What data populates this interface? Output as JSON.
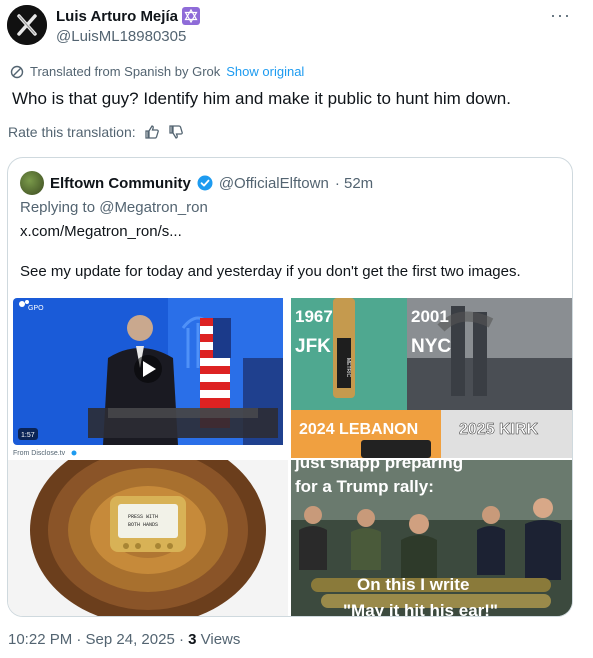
{
  "author": {
    "name": "Luis Arturo Mejía",
    "handle": "@LuisML18980305"
  },
  "translation": {
    "note": "Translated from Spanish by Grok",
    "show_original": "Show original",
    "rate_label": "Rate this translation:"
  },
  "tweet_text": "Who is that guy? Identify him and make it public to hunt him down.",
  "quoted": {
    "name": "Elftown Community",
    "handle": "@OfficialElftown",
    "time": "· 52m",
    "replying": "Replying to @Megatron_ron",
    "link": "x.com/Megatron_ron/s...",
    "text": "See my update for today and yesterday if you don't get the first two images.",
    "images": {
      "img1": {
        "badge": "GPO",
        "duration": "1:57",
        "credit": "From Disclose.tv"
      },
      "img2": {
        "top_left": "1967\nJFK",
        "top_right": "2001\nNYC",
        "bottom_left": "2024 LEBANON",
        "bottom_right": "2025 KIRK",
        "cartridge": "METRIC"
      },
      "img3": {
        "pager_text": "PRESS WITH BOTH HANDS"
      },
      "img4": {
        "caption_top": "for a Trump rally:",
        "caption_bottom": "On this I write",
        "caption_cut": "\"May it hit his ear!\""
      }
    }
  },
  "footer": {
    "time": "10:22 PM · Sep 24, 2025 · ",
    "views_count": "3",
    "views_label": " Views"
  },
  "colors": {
    "accent": "#1d9bf0",
    "muted": "#536471",
    "badge": "#8e6bd8"
  }
}
